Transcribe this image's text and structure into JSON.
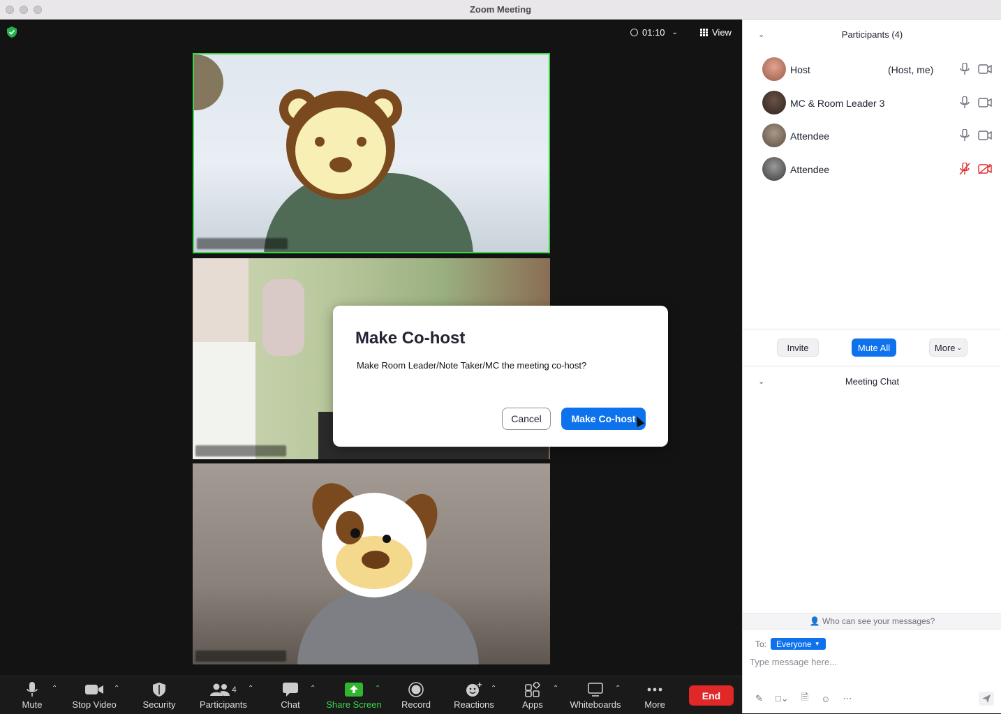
{
  "window": {
    "title": "Zoom Meeting"
  },
  "meeting": {
    "timer": "01:10",
    "view_label": "View",
    "dialog": {
      "title": "Make Co-host",
      "message": "Make Room Leader/Note Taker/MC the meeting co-host?",
      "cancel_label": "Cancel",
      "confirm_label": "Make Co-host"
    }
  },
  "toolbar": {
    "mute": "Mute",
    "stop_video": "Stop Video",
    "security": "Security",
    "participants": "Participants",
    "participants_count": "4",
    "chat": "Chat",
    "share_screen": "Share Screen",
    "record": "Record",
    "reactions": "Reactions",
    "apps": "Apps",
    "whiteboards": "Whiteboards",
    "more": "More",
    "end": "End"
  },
  "participants_panel": {
    "title": "Participants (4)",
    "rows": [
      {
        "name": "Host",
        "role": "(Host, me)",
        "muted": false,
        "video_off": false
      },
      {
        "name": "MC & Room Leader 3",
        "role": "",
        "muted": false,
        "video_off": false
      },
      {
        "name": "Attendee",
        "role": "",
        "muted": false,
        "video_off": false
      },
      {
        "name": "Attendee",
        "role": "",
        "muted": true,
        "video_off": true
      }
    ],
    "invite_label": "Invite",
    "mute_all_label": "Mute All",
    "more_label": "More"
  },
  "chat_panel": {
    "title": "Meeting Chat",
    "who_can_see": "Who can see your messages?",
    "to_label": "To:",
    "recipient": "Everyone",
    "placeholder": "Type message here..."
  },
  "colors": {
    "accent": "#0e72ed",
    "end": "#e02828",
    "active_speaker": "#3dd84a",
    "muted_red": "#e02828"
  }
}
